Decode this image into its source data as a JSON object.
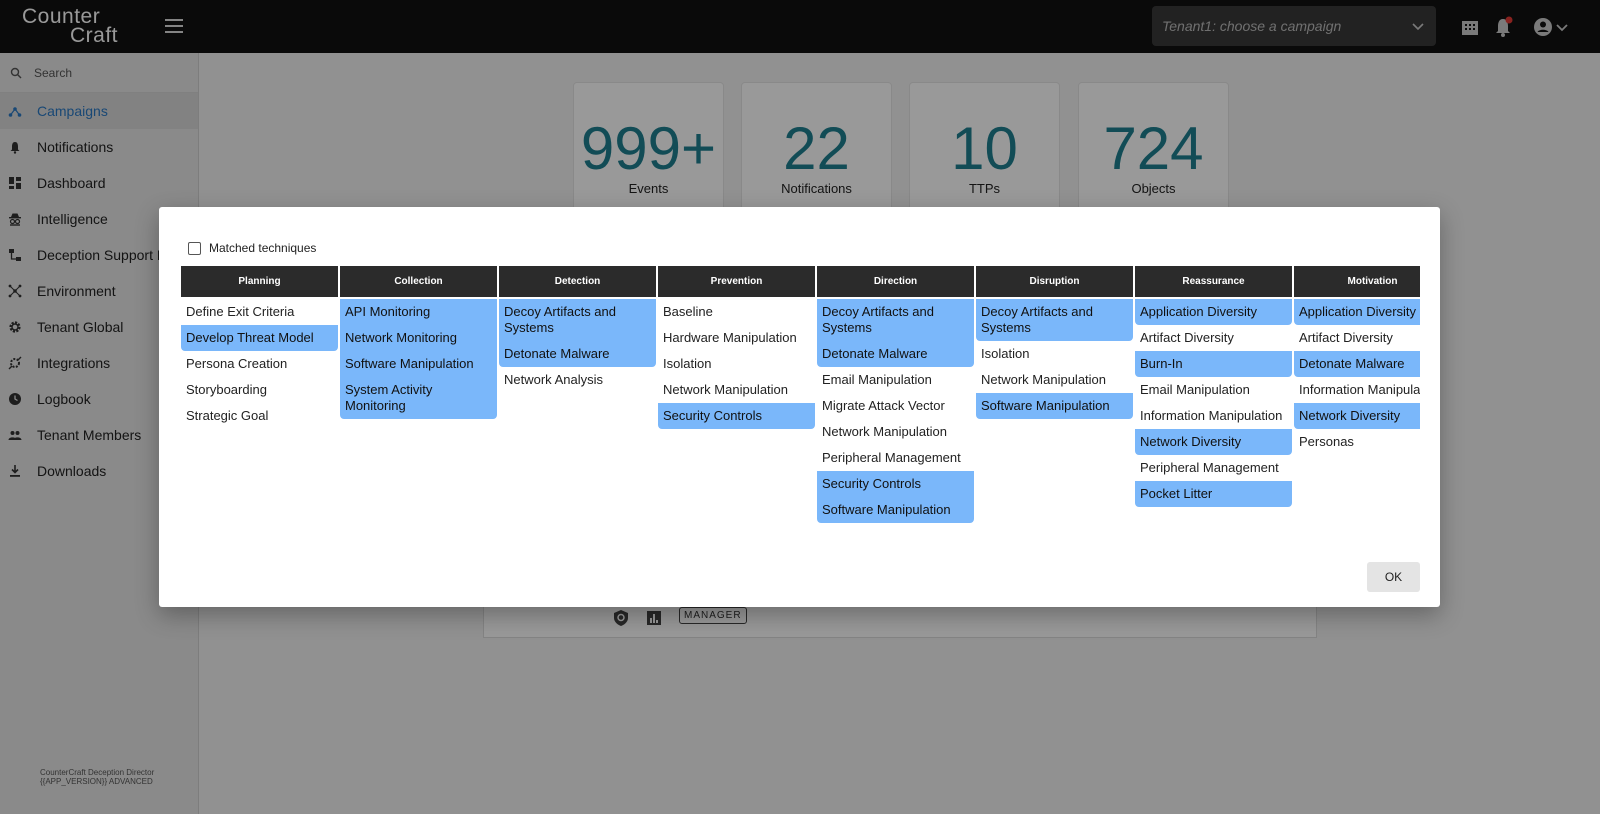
{
  "header": {
    "logo_line1": "Counter",
    "logo_line2": "Craft",
    "campaign_placeholder": "Tenant1: choose a campaign"
  },
  "sidebar": {
    "search_placeholder": "Search",
    "items": [
      {
        "label": "Campaigns",
        "icon": "campaigns-icon",
        "active": true
      },
      {
        "label": "Notifications",
        "icon": "bell-icon"
      },
      {
        "label": "Dashboard",
        "icon": "dashboard-icon"
      },
      {
        "label": "Intelligence",
        "icon": "spy-icon"
      },
      {
        "label": "Deception Support N",
        "icon": "flow-icon"
      },
      {
        "label": "Environment",
        "icon": "network-icon"
      },
      {
        "label": "Tenant Global",
        "icon": "gear-icon"
      },
      {
        "label": "Integrations",
        "icon": "integrations-icon"
      },
      {
        "label": "Logbook",
        "icon": "clock-icon"
      },
      {
        "label": "Tenant Members",
        "icon": "people-icon"
      },
      {
        "label": "Downloads",
        "icon": "download-icon"
      }
    ],
    "footer_line1": "CounterCraft Deception Director",
    "footer_line2": "{{APP_VERSION}} ADVANCED"
  },
  "stats": [
    {
      "value": "999+",
      "label": "Events"
    },
    {
      "value": "22",
      "label": "Notifications"
    },
    {
      "value": "10",
      "label": "TTPs"
    },
    {
      "value": "724",
      "label": "Objects"
    }
  ],
  "bg_card": {
    "badge": "MANAGER"
  },
  "dialog": {
    "matched_label": "Matched techniques",
    "ok_label": "OK",
    "highlight_color": "#7ab7fa",
    "columns": [
      {
        "title": "Planning",
        "items": [
          {
            "t": "Define Exit Criteria",
            "h": false
          },
          {
            "t": "Develop Threat Model",
            "h": true
          },
          {
            "t": "Persona Creation",
            "h": false
          },
          {
            "t": "Storyboarding",
            "h": false
          },
          {
            "t": "Strategic Goal",
            "h": false
          }
        ]
      },
      {
        "title": "Collection",
        "items": [
          {
            "t": "API Monitoring",
            "h": true
          },
          {
            "t": "Network Monitoring",
            "h": true
          },
          {
            "t": "Software Manipulation",
            "h": true
          },
          {
            "t": "System Activity Monitoring",
            "h": true
          }
        ]
      },
      {
        "title": "Detection",
        "items": [
          {
            "t": "Decoy Artifacts and Systems",
            "h": true
          },
          {
            "t": "Detonate Malware",
            "h": true
          },
          {
            "t": "Network Analysis",
            "h": false
          }
        ]
      },
      {
        "title": "Prevention",
        "items": [
          {
            "t": "Baseline",
            "h": false
          },
          {
            "t": "Hardware Manipulation",
            "h": false
          },
          {
            "t": "Isolation",
            "h": false
          },
          {
            "t": "Network Manipulation",
            "h": false
          },
          {
            "t": "Security Controls",
            "h": true
          }
        ]
      },
      {
        "title": "Direction",
        "items": [
          {
            "t": "Decoy Artifacts and Systems",
            "h": true
          },
          {
            "t": "Detonate Malware",
            "h": true
          },
          {
            "t": "Email Manipulation",
            "h": false
          },
          {
            "t": "Migrate Attack Vector",
            "h": false
          },
          {
            "t": "Network Manipulation",
            "h": false
          },
          {
            "t": "Peripheral Management",
            "h": false
          },
          {
            "t": "Security Controls",
            "h": true
          },
          {
            "t": "Software Manipulation",
            "h": true
          }
        ]
      },
      {
        "title": "Disruption",
        "items": [
          {
            "t": "Decoy Artifacts and Systems",
            "h": true
          },
          {
            "t": "Isolation",
            "h": false
          },
          {
            "t": "Network Manipulation",
            "h": false
          },
          {
            "t": "Software Manipulation",
            "h": true
          }
        ]
      },
      {
        "title": "Reassurance",
        "items": [
          {
            "t": "Application Diversity",
            "h": true
          },
          {
            "t": "Artifact Diversity",
            "h": false
          },
          {
            "t": "Burn-In",
            "h": true
          },
          {
            "t": "Email Manipulation",
            "h": false
          },
          {
            "t": "Information Manipulation",
            "h": false
          },
          {
            "t": "Network Diversity",
            "h": true
          },
          {
            "t": "Peripheral Management",
            "h": false
          },
          {
            "t": "Pocket Litter",
            "h": true
          }
        ]
      },
      {
        "title": "Motivation",
        "items": [
          {
            "t": "Application Diversity",
            "h": true
          },
          {
            "t": "Artifact Diversity",
            "h": false
          },
          {
            "t": "Detonate Malware",
            "h": true
          },
          {
            "t": "Information Manipulation",
            "h": false
          },
          {
            "t": "Network Diversity",
            "h": true
          },
          {
            "t": "Personas",
            "h": false
          }
        ]
      }
    ]
  }
}
